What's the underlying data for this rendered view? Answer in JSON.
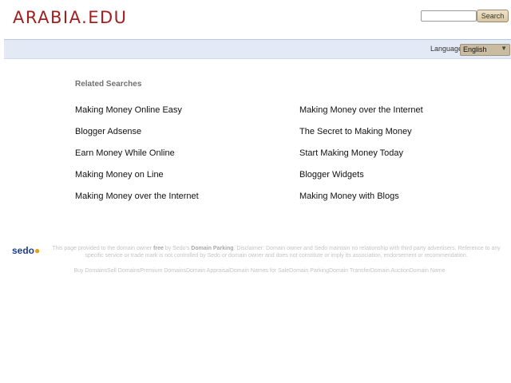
{
  "header": {
    "logo": "ARABIA.EDU",
    "search_placeholder": "",
    "search_button": "Search"
  },
  "language": {
    "label": "Language:",
    "selected": "English"
  },
  "related": {
    "heading": "Related Searches",
    "left": [
      "Making Money Online Easy",
      "Blogger Adsense",
      "Earn Money While Online",
      "Making Money on Line",
      "Making Money over the Internet"
    ],
    "right": [
      "Making Money over the Internet",
      "The Secret to Making Money",
      "Start Making Money Today",
      "Blogger Widgets",
      "Making Money with Blogs"
    ]
  },
  "footer": {
    "sedo_logo": "sedo",
    "disclaimer_1": "This page provided to the domain owner ",
    "disclaimer_free": "free",
    "disclaimer_2": " by Sedo's ",
    "disclaimer_parking": "Domain Parking",
    "disclaimer_3": ". Disclaimer: Domain owner and Sedo maintain no relationship with third party advertisers. Reference to any specific service or trade mark is not controlled by Sedo or domain owner and does not constitute or imply its association, endorsement or recommendation.",
    "links": [
      "Buy Domains",
      "Sell Domains",
      "Premium Domains",
      "Domain Appraisal",
      "Domain Names for Sale",
      "Domain Parking",
      "Domain Transfer",
      "Domain Auction",
      "Domain Name"
    ]
  }
}
